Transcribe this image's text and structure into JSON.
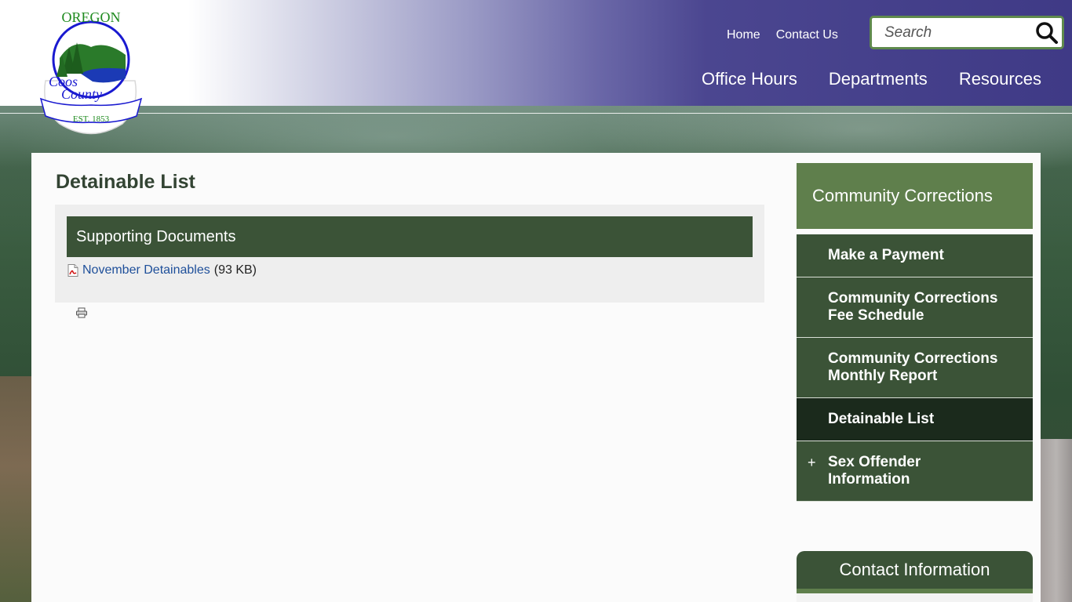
{
  "header": {
    "logo": {
      "top_text": "OREGON",
      "name_line1": "Coos",
      "name_line2": "County",
      "established": "EST. 1853"
    },
    "top_links": [
      {
        "label": "Home"
      },
      {
        "label": "Contact Us"
      }
    ],
    "search": {
      "placeholder": "Search"
    },
    "main_nav": [
      {
        "label": "Office Hours"
      },
      {
        "label": "Departments"
      },
      {
        "label": "Resources"
      }
    ]
  },
  "main": {
    "title": "Detainable List",
    "documents": {
      "header": "Supporting Documents",
      "items": [
        {
          "name": "November Detainables",
          "size": "(93 KB)",
          "icon": "pdf-icon"
        }
      ]
    },
    "print_icon": "printer-icon"
  },
  "sidebar": {
    "heading": "Community Corrections",
    "items": [
      {
        "label": "Make a Payment"
      },
      {
        "label": "Community Corrections Fee Schedule"
      },
      {
        "label": "Community Corrections Monthly Report"
      },
      {
        "label": "Detainable List"
      },
      {
        "label": "Sex Offender Information",
        "expand": "+"
      }
    ],
    "contact_heading": "Contact Information"
  },
  "colors": {
    "header_purple": "#3f3a86",
    "dark_green": "#3b5337",
    "mid_green": "#5f7f4c",
    "active_green": "#1b2a1c",
    "link_blue": "#1e4f9a"
  }
}
